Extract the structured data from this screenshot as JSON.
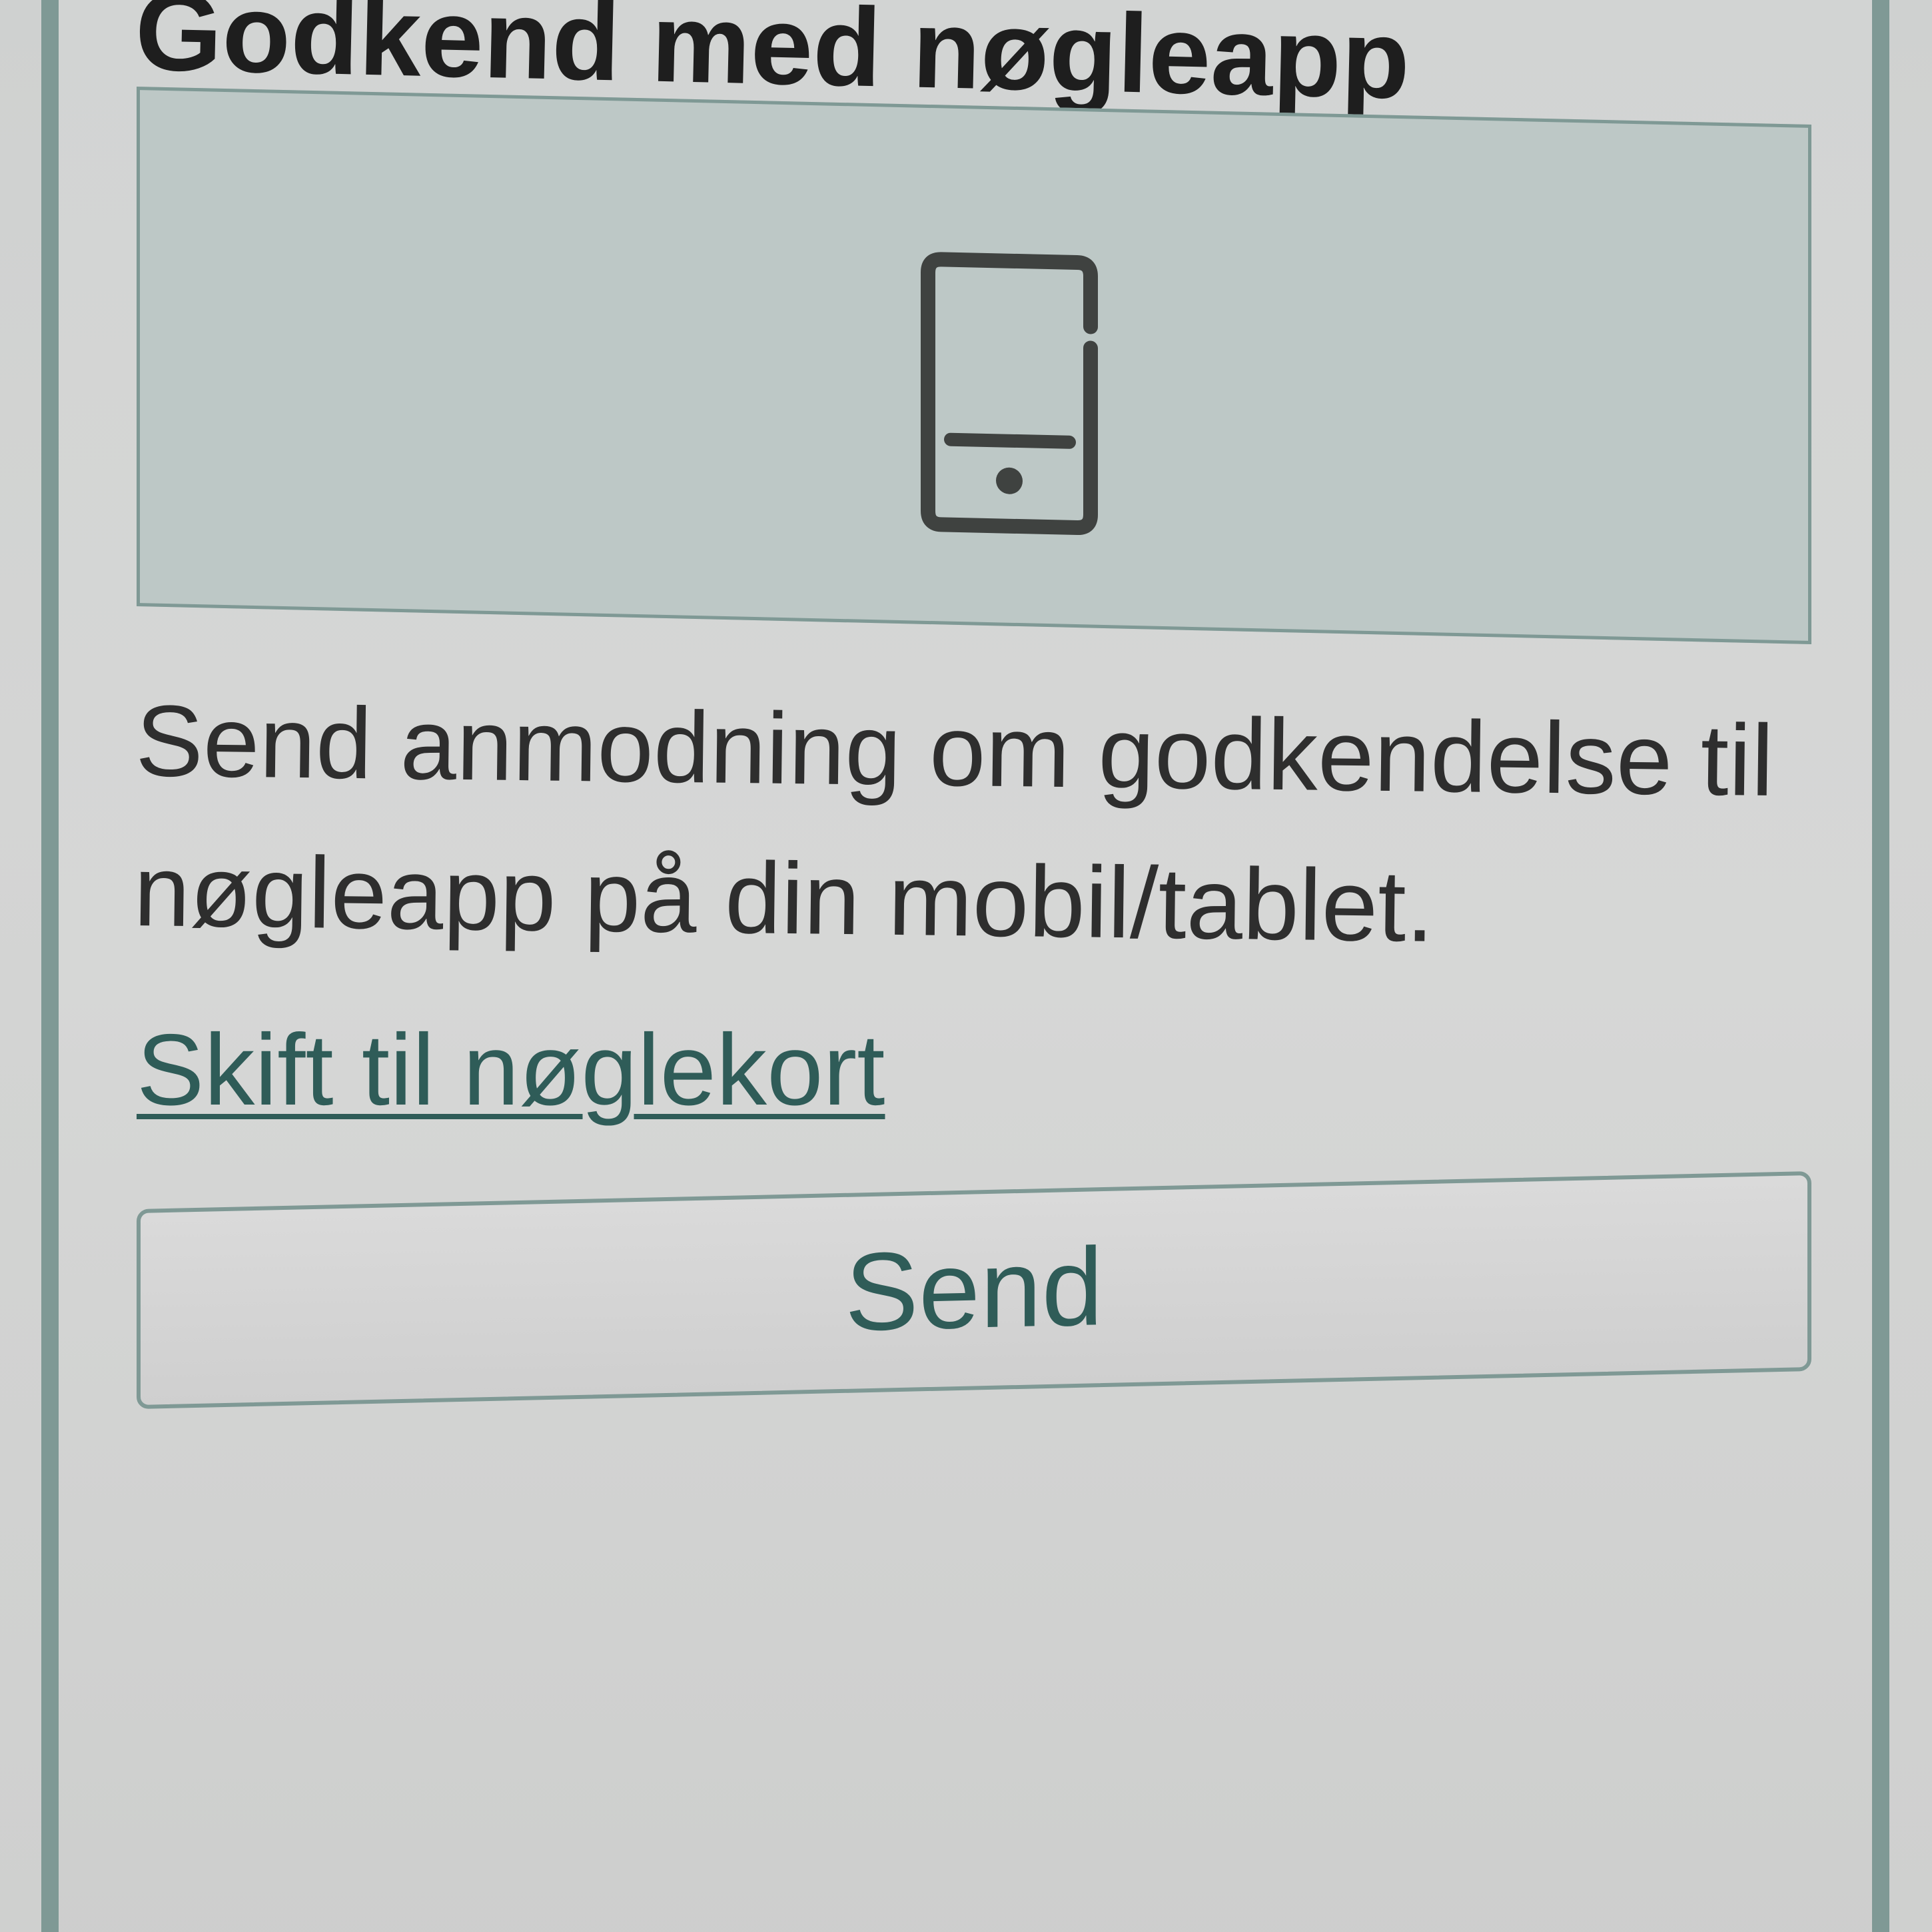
{
  "header": {
    "title": "Godkend med nøgleapp"
  },
  "icon_panel": {
    "icon": "mobile-tablet-icon"
  },
  "main": {
    "description": "Send anmodning om godkendelse til nøgleapp på din mobil/tablet.",
    "switch_link_label": "Skift til nøglekort",
    "send_button_label": "Send"
  },
  "colors": {
    "accent": "#2f5c58",
    "border": "#7f9995",
    "icon_panel_bg": "#bdc8c6",
    "text": "#2e2e2e"
  }
}
